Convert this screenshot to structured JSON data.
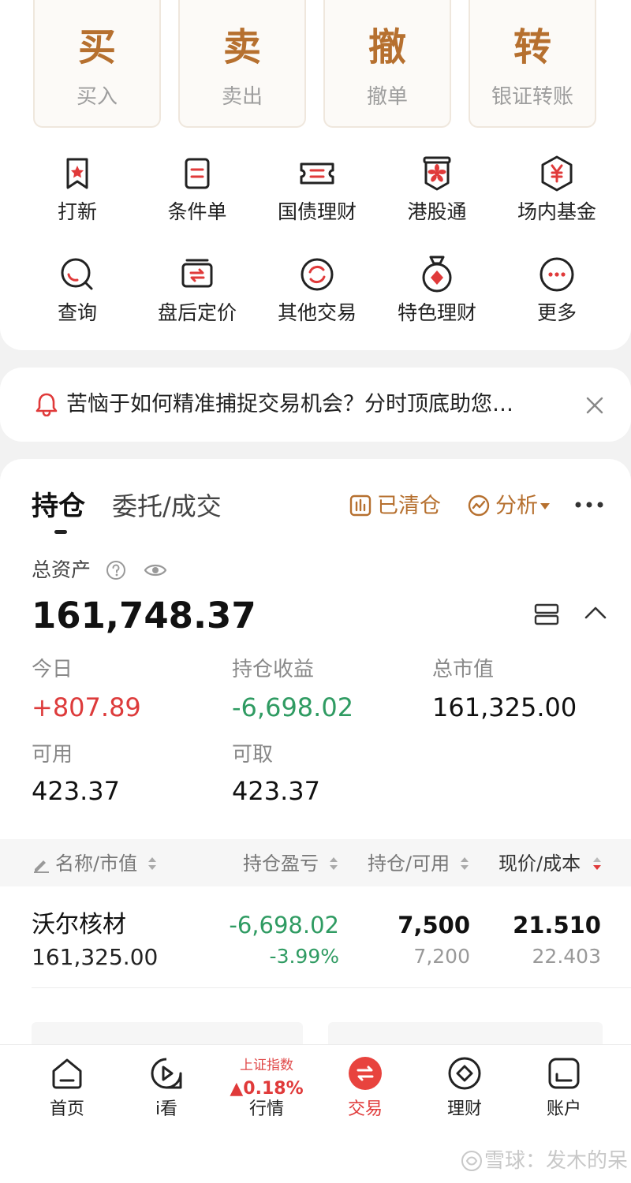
{
  "quick_actions": [
    {
      "big": "买",
      "label": "买入"
    },
    {
      "big": "卖",
      "label": "卖出"
    },
    {
      "big": "撤",
      "label": "撤单"
    },
    {
      "big": "转",
      "label": "银证转账"
    }
  ],
  "grid": {
    "row1": [
      {
        "label": "打新",
        "icon": "new-stock-icon"
      },
      {
        "label": "条件单",
        "icon": "condition-order-icon"
      },
      {
        "label": "国债理财",
        "icon": "treasury-bond-icon"
      },
      {
        "label": "港股通",
        "icon": "hk-connect-icon"
      },
      {
        "label": "场内基金",
        "icon": "exchange-fund-icon"
      }
    ],
    "row2": [
      {
        "label": "查询",
        "icon": "query-icon"
      },
      {
        "label": "盘后定价",
        "icon": "after-hours-pricing-icon"
      },
      {
        "label": "其他交易",
        "icon": "other-trade-icon"
      },
      {
        "label": "特色理财",
        "icon": "featured-wealth-icon"
      },
      {
        "label": "更多",
        "icon": "more-icon"
      }
    ]
  },
  "notice": {
    "text": "苦恼于如何精准捕捉交易机会？分时顶底助您…"
  },
  "tabs": {
    "active": "持仓",
    "other": "委托/成交",
    "cleared": "已清仓",
    "analysis": "分析"
  },
  "assets": {
    "total_label": "总资产",
    "total_value": "161,748.37",
    "today_label": "今日",
    "today_value": "+807.89",
    "position_pnl_label": "持仓收益",
    "position_pnl_value": "-6,698.02",
    "market_value_label": "总市值",
    "market_value_value": "161,325.00",
    "available_label": "可用",
    "available_value": "423.37",
    "withdrawable_label": "可取",
    "withdrawable_value": "423.37"
  },
  "table": {
    "headers": {
      "name": "名称/市值",
      "pnl": "持仓盈亏",
      "position": "持仓/可用",
      "price": "现价/成本"
    },
    "rows": [
      {
        "name": "沃尔核材",
        "market_value": "161,325.00",
        "pnl": "-6,698.02",
        "pnl_pct": "-3.99%",
        "position": "7,500",
        "available": "7,200",
        "price": "21.510",
        "cost": "22.403"
      }
    ]
  },
  "bottom_nav": {
    "items": [
      {
        "label": "首页",
        "icon": "home-icon"
      },
      {
        "label": "i看",
        "icon": "play-icon"
      },
      {
        "label": "交易",
        "icon": "trade-icon"
      },
      {
        "label": "理财",
        "icon": "wealth-icon"
      },
      {
        "label": "账户",
        "icon": "account-icon"
      }
    ],
    "market": {
      "index_name": "上证指数",
      "index_change": "▲0.18%",
      "label": "行情"
    }
  },
  "watermark": {
    "text": "雪球：发木的呆"
  },
  "colors": {
    "accent_gold": "#b6702f",
    "up_red": "#dd3b3b",
    "down_green": "#2f9b62",
    "active_red": "#e03a3a"
  }
}
